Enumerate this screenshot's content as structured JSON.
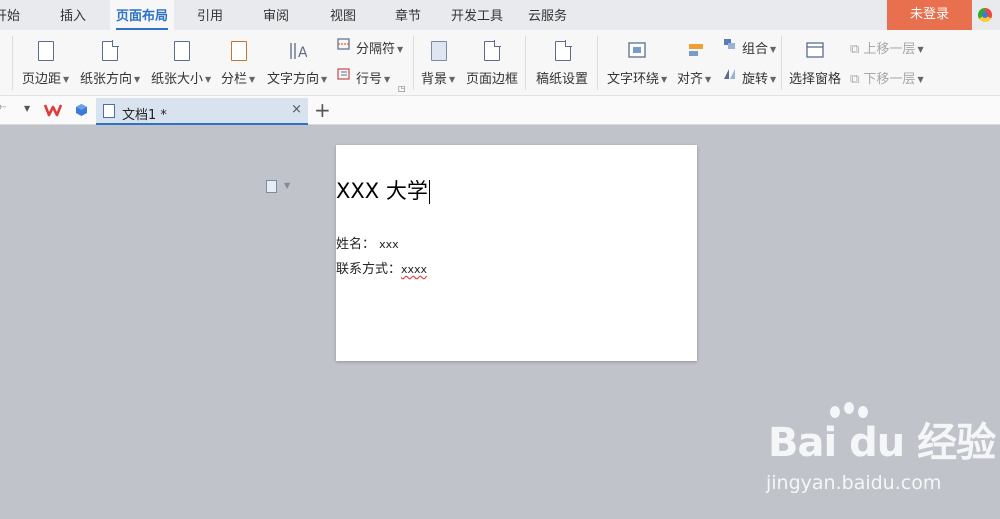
{
  "menu": {
    "tabs": [
      "开始",
      "插入",
      "页面布局",
      "引用",
      "审阅",
      "视图",
      "章节",
      "开发工具",
      "云服务"
    ],
    "active": "页面布局",
    "login_label": "未登录"
  },
  "ribbon": {
    "page_margin": "页边距",
    "orientation": "纸张方向",
    "paper_size": "纸张大小",
    "columns": "分栏",
    "text_direction": "文字方向",
    "separator": "分隔符",
    "line_number": "行号",
    "background": "背景",
    "page_border": "页面边框",
    "manuscript": "稿纸设置",
    "text_wrap": "文字环绕",
    "align": "对齐",
    "group": "组合",
    "rotate": "旋转",
    "selection_pane": "选择窗格",
    "bring_forward": "上移一层",
    "send_backward": "下移一层"
  },
  "tabs": {
    "doc_tab_label": "文档1 *",
    "close_glyph": "×",
    "new_glyph": "+"
  },
  "document": {
    "title": "XXX 大学",
    "name_label": "姓名：",
    "name_value": "xxx",
    "contact_label": "联系方式：",
    "contact_value": "xxxx"
  },
  "watermark": {
    "logo": "Bai du 经验",
    "url": "jingyan.baidu.com"
  },
  "colors": {
    "accent": "#2f73c8",
    "login_bg": "#e8704f",
    "canvas_bg": "#c1c3ca"
  },
  "icons": [
    "wps-logo-icon",
    "cube-icon",
    "document-icon",
    "dropdown-icon",
    "close-icon",
    "add-tab-icon",
    "paragraph-icon"
  ]
}
